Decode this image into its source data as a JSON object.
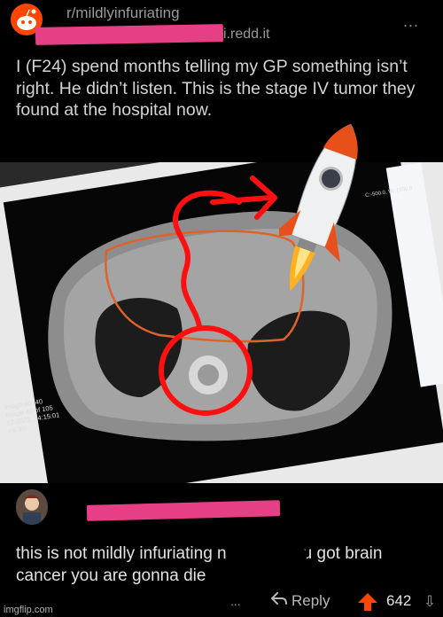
{
  "post": {
    "subreddit": "r/mildlyinfuriating",
    "domain": "i.redd.it",
    "more": "...",
    "title": "I (F24) spend months telling my GP something isn’t right. He didn’t listen. This is the stage IV tumor they found at the hospital now."
  },
  "scan": {
    "info_lines": [
      "Image no: 40",
      "Image 40 of 105",
      "12.2022, 14:15:01",
      "es: 10"
    ],
    "window_label": "C:-500.0, W: 1500.0"
  },
  "comment": {
    "text_before": "this is not mildly infuriating  n",
    "text_after": "you got brain cancer you are gonna die",
    "more": "...",
    "reply_label": "Reply",
    "score": "642"
  },
  "watermark": "imgflip.com",
  "colors": {
    "redaction": "#e63f86",
    "upvote": "#ff4500",
    "drawing": "#ff1010"
  },
  "icons": [
    "reddit-snoo-icon",
    "rocket-icon",
    "reply-icon",
    "upvote-icon",
    "downvote-icon"
  ]
}
